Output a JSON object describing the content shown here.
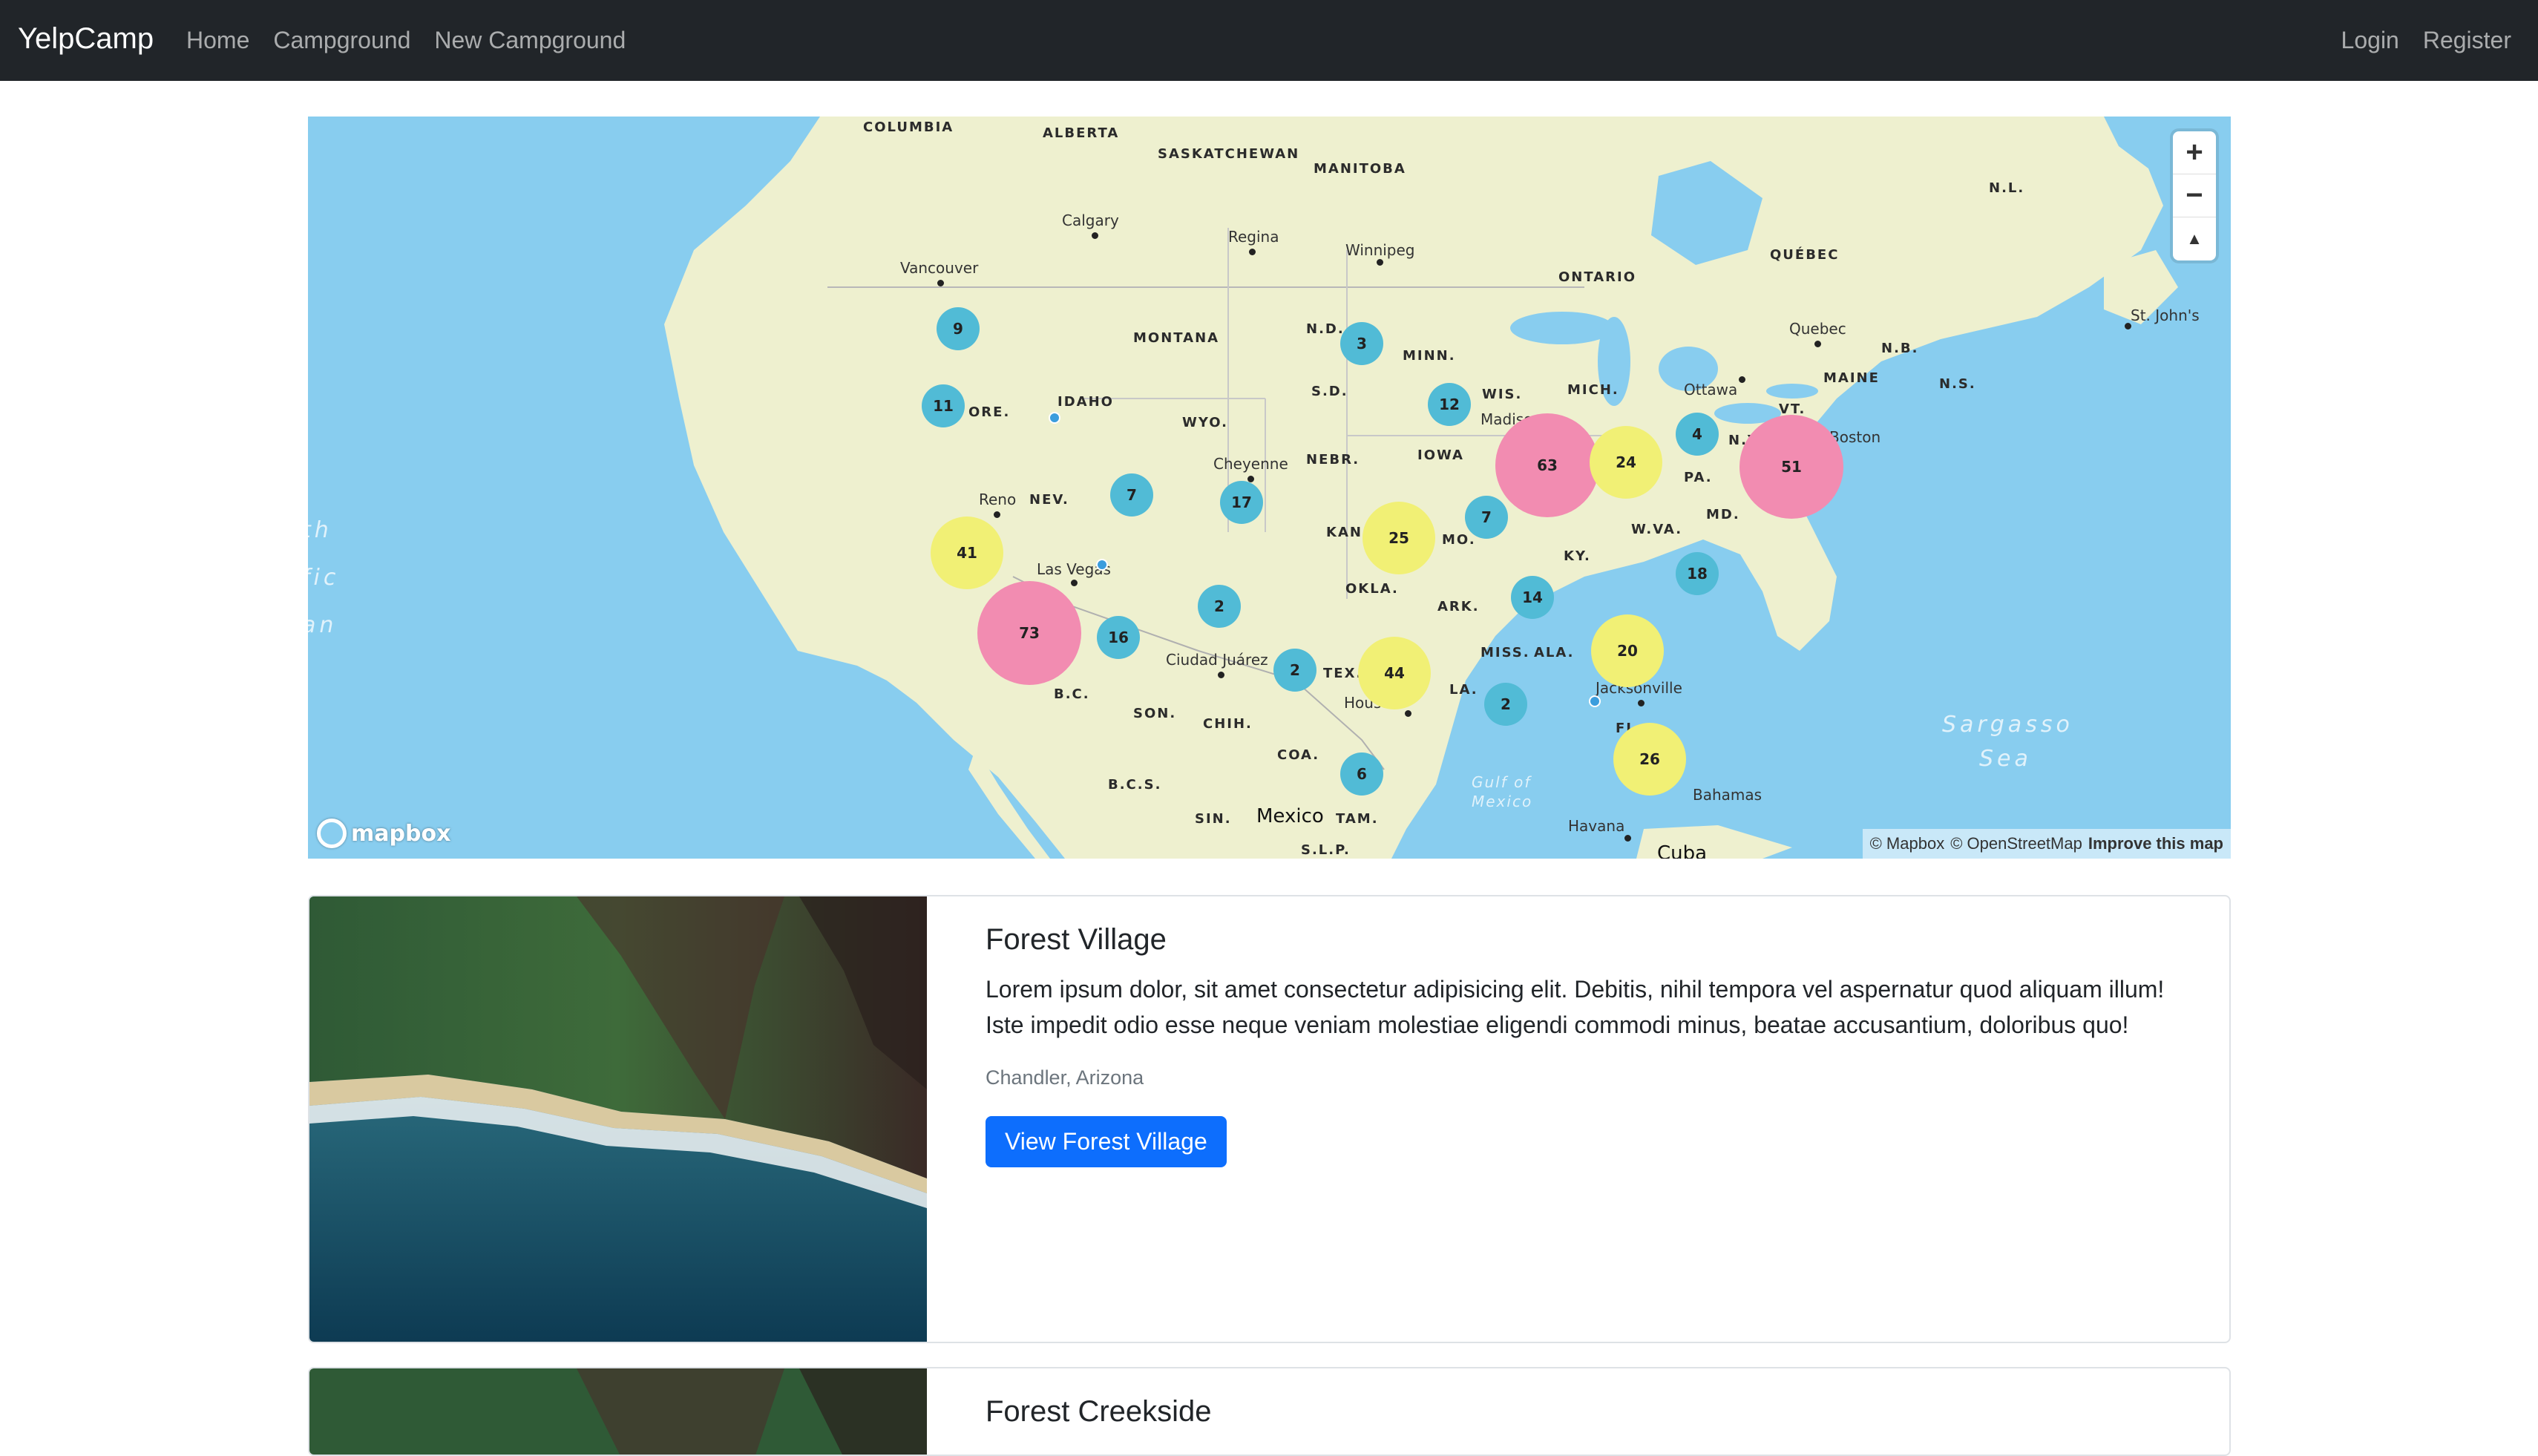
{
  "navbar": {
    "brand": "YelpCamp",
    "links": [
      "Home",
      "Campground",
      "New Campground"
    ],
    "right_links": [
      "Login",
      "Register"
    ]
  },
  "map": {
    "regions": {
      "columbia": "COLUMBIA",
      "alberta": "ALBERTA",
      "saskatchewan": "SASKATCHEWAN",
      "manitoba": "MANITOBA",
      "ontario": "ONTARIO",
      "quebec": "QUÉBEC",
      "nl": "N.L.",
      "nb": "N.B.",
      "ns": "N.S.",
      "montana": "MONTANA",
      "nd": "N.D.",
      "minn": "MINN.",
      "sd": "S.D.",
      "wis": "WIS.",
      "mich": "MICH.",
      "idaho": "IDAHO",
      "ore": "ORE.",
      "wyo": "WYO.",
      "nebr": "NEBR.",
      "iowa": "IOWA",
      "nev": "NEV.",
      "kan": "KAN",
      "mo": "MO.",
      "okla": "OKLA.",
      "ark": "ARK.",
      "ky": "KY.",
      "wva": "W.VA.",
      "pa": "PA.",
      "md": "MD.",
      "maine": "MAINE",
      "vt": "VT.",
      "ny": "N.Y.",
      "tex": "TEX.",
      "la": "LA.",
      "miss": "MISS.",
      "ala": "ALA.",
      "fl": "FL",
      "son": "SON.",
      "chih": "CHIH.",
      "coa": "COA.",
      "bc": "B.C.",
      "bcs": "B.C.S.",
      "sin": "SIN.",
      "tam": "TAM.",
      "slp": "S.L.P."
    },
    "cities": {
      "calgary": "Calgary",
      "regina": "Regina",
      "winnipeg": "Winnipeg",
      "vancouver": "Vancouver",
      "quebec_city": "Quebec",
      "st_johns": "St. John's",
      "ottawa": "Ottawa",
      "boston": "Boston",
      "madison": "Madison",
      "cheyenne": "Cheyenne",
      "reno": "Reno",
      "las_vegas": "Las Vegas",
      "ciudad_juarez": "Ciudad Juárez",
      "houston": "Houston",
      "jacksonville": "Jacksonville",
      "havana": "Havana",
      "bahamas": "Bahamas"
    },
    "countries": {
      "mexico": "Mexico",
      "cuba": "Cuba"
    },
    "oceans": {
      "pacific_1": "th",
      "pacific_2": "fic",
      "pacific_3": "an",
      "sargasso_1": "Sargasso",
      "sargasso_2": "Sea",
      "gulf": "Gulf of Mexico"
    },
    "clusters": [
      {
        "count": "9",
        "size": "small"
      },
      {
        "count": "11",
        "size": "small"
      },
      {
        "count": "3",
        "size": "small"
      },
      {
        "count": "12",
        "size": "small"
      },
      {
        "count": "63",
        "size": "large"
      },
      {
        "count": "24",
        "size": "medium"
      },
      {
        "count": "4",
        "size": "small"
      },
      {
        "count": "51",
        "size": "large"
      },
      {
        "count": "7",
        "size": "small"
      },
      {
        "count": "17",
        "size": "small"
      },
      {
        "count": "25",
        "size": "medium"
      },
      {
        "count": "7",
        "size": "small"
      },
      {
        "count": "41",
        "size": "medium"
      },
      {
        "count": "73",
        "size": "large"
      },
      {
        "count": "16",
        "size": "small"
      },
      {
        "count": "2",
        "size": "small"
      },
      {
        "count": "14",
        "size": "small"
      },
      {
        "count": "18",
        "size": "small"
      },
      {
        "count": "2",
        "size": "small"
      },
      {
        "count": "44",
        "size": "medium"
      },
      {
        "count": "20",
        "size": "medium"
      },
      {
        "count": "2",
        "size": "small"
      },
      {
        "count": "26",
        "size": "medium"
      },
      {
        "count": "6",
        "size": "small"
      }
    ],
    "controls": {
      "zoom_in": "+",
      "zoom_out": "−",
      "compass": "▲"
    },
    "logo_text": "mapbox",
    "attribution": {
      "mapbox": "© Mapbox",
      "osm": "© OpenStreetMap",
      "improve": "Improve this map"
    }
  },
  "campgrounds": [
    {
      "title": "Forest Village",
      "description": "Lorem ipsum dolor, sit amet consectetur adipisicing elit. Debitis, nihil tempora vel aspernatur quod aliquam illum! Iste impedit odio esse neque veniam molestiae eligendi commodi minus, beatae accusantium, doloribus quo!",
      "location": "Chandler, Arizona",
      "button": "View Forest Village"
    },
    {
      "title": "Forest Creekside"
    }
  ],
  "colors": {
    "navbar": "#212529",
    "primary": "#0d6efd",
    "cluster_small": "#51bbd6",
    "cluster_medium": "#f1f075",
    "cluster_large": "#f28cb1",
    "water": "#88cdef",
    "land": "#eef0cf"
  }
}
